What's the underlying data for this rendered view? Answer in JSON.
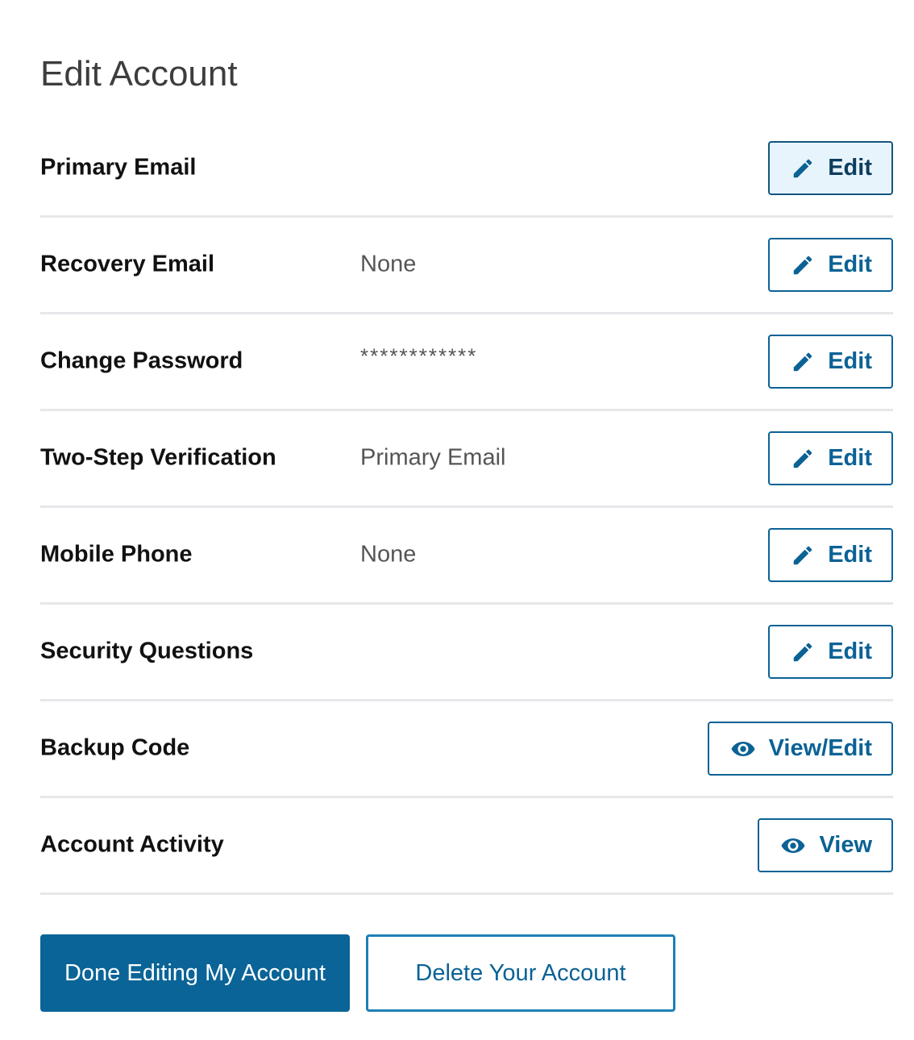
{
  "page": {
    "title": "Edit Account"
  },
  "rows": [
    {
      "label": "Primary Email",
      "value": "",
      "action": "Edit",
      "icon": "pencil-icon",
      "active": true
    },
    {
      "label": "Recovery Email",
      "value": "None",
      "action": "Edit",
      "icon": "pencil-icon"
    },
    {
      "label": "Change Password",
      "value": "************",
      "action": "Edit",
      "icon": "pencil-icon"
    },
    {
      "label": "Two-Step Verification",
      "value": "Primary Email",
      "action": "Edit",
      "icon": "pencil-icon"
    },
    {
      "label": "Mobile Phone",
      "value": "None",
      "action": "Edit",
      "icon": "pencil-icon"
    },
    {
      "label": "Security Questions",
      "value": "",
      "action": "Edit",
      "icon": "pencil-icon"
    },
    {
      "label": "Backup Code",
      "value": "",
      "action": "View/Edit",
      "icon": "eye-icon"
    },
    {
      "label": "Account Activity",
      "value": "",
      "action": "View",
      "icon": "eye-icon"
    }
  ],
  "footer": {
    "done_label": "Done Editing My Account",
    "delete_label": "Delete Your Account"
  },
  "colors": {
    "accent": "#0a6497",
    "active_button_bg": "#e8f4fc",
    "divider": "#e6e7ea"
  }
}
